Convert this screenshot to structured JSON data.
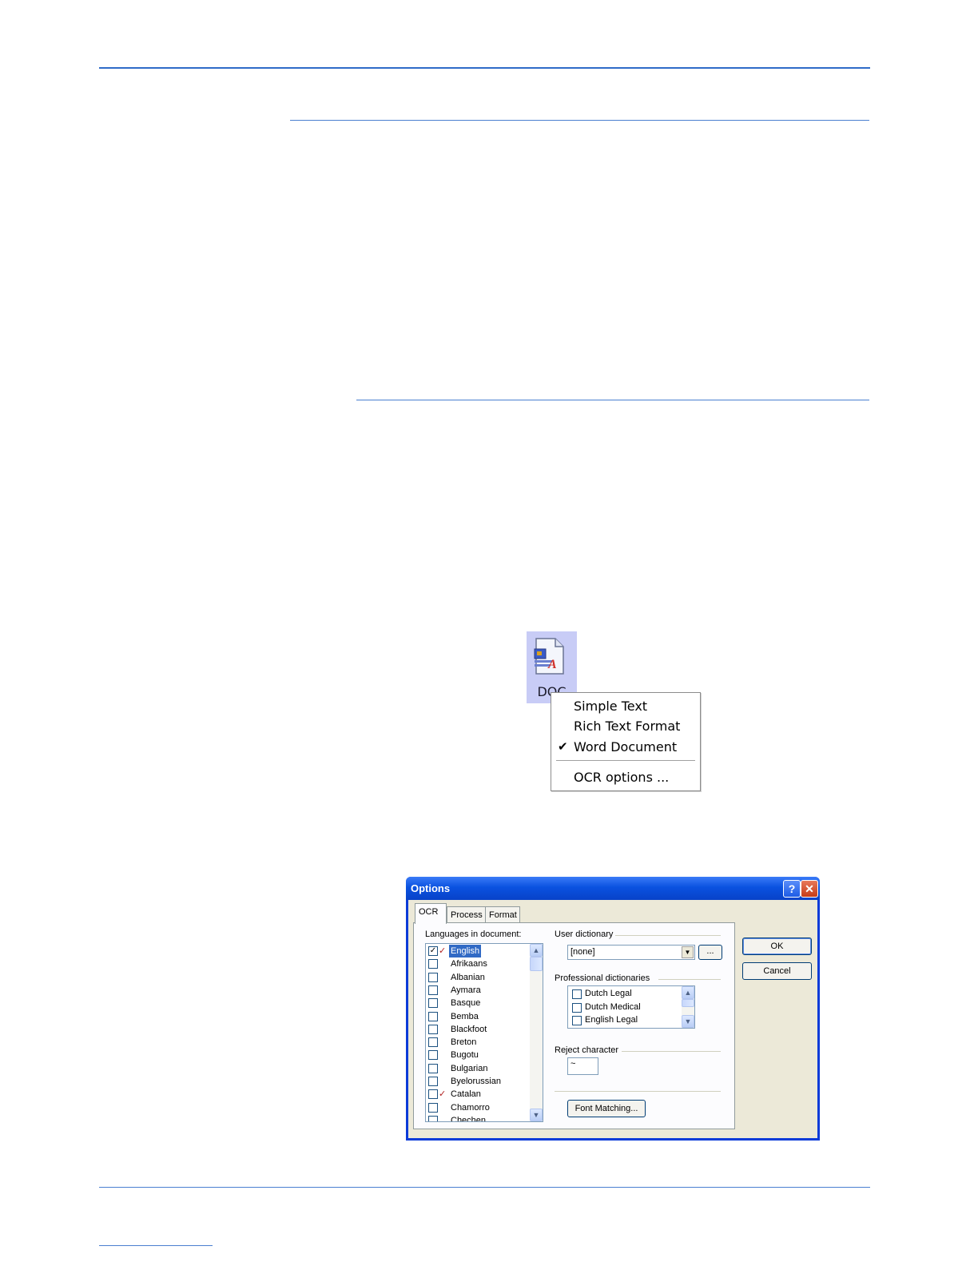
{
  "icon": {
    "label": "DOC",
    "semantic": "document-format-icon"
  },
  "context_menu": {
    "items": [
      {
        "label": "Simple Text",
        "checked": false
      },
      {
        "label": "Rich Text Format",
        "checked": false
      },
      {
        "label": "Word Document",
        "checked": true
      },
      {
        "label": "OCR options ...",
        "checked": false
      }
    ],
    "check_glyph": "✔"
  },
  "dialog": {
    "title": "Options",
    "help_label": "?",
    "close_label": "✕",
    "tabs": [
      {
        "label": "OCR",
        "active": true
      },
      {
        "label": "Process",
        "active": false
      },
      {
        "label": "Format",
        "active": false
      }
    ],
    "languages_label": "Languages in document:",
    "languages": [
      {
        "name": "English",
        "checked": true,
        "selected": true,
        "flag": true
      },
      {
        "name": "Afrikaans",
        "checked": false,
        "selected": false,
        "flag": false
      },
      {
        "name": "Albanian",
        "checked": false,
        "selected": false,
        "flag": false
      },
      {
        "name": "Aymara",
        "checked": false,
        "selected": false,
        "flag": false
      },
      {
        "name": "Basque",
        "checked": false,
        "selected": false,
        "flag": false
      },
      {
        "name": "Bemba",
        "checked": false,
        "selected": false,
        "flag": false
      },
      {
        "name": "Blackfoot",
        "checked": false,
        "selected": false,
        "flag": false
      },
      {
        "name": "Breton",
        "checked": false,
        "selected": false,
        "flag": false
      },
      {
        "name": "Bugotu",
        "checked": false,
        "selected": false,
        "flag": false
      },
      {
        "name": "Bulgarian",
        "checked": false,
        "selected": false,
        "flag": false
      },
      {
        "name": "Byelorussian",
        "checked": false,
        "selected": false,
        "flag": false
      },
      {
        "name": "Catalan",
        "checked": false,
        "selected": false,
        "flag": true
      },
      {
        "name": "Chamorro",
        "checked": false,
        "selected": false,
        "flag": false
      },
      {
        "name": "Chechen",
        "checked": false,
        "selected": false,
        "flag": false
      }
    ],
    "user_dictionary_label": "User dictionary",
    "user_dictionary_value": "[none]",
    "browse_label": "...",
    "professional_label": "Professional dictionaries",
    "professional_dictionaries": [
      "Dutch Legal",
      "Dutch Medical",
      "English Legal"
    ],
    "reject_label": "Reject character",
    "reject_value": "~",
    "font_matching_label": "Font Matching...",
    "ok_label": "OK",
    "cancel_label": "Cancel"
  }
}
